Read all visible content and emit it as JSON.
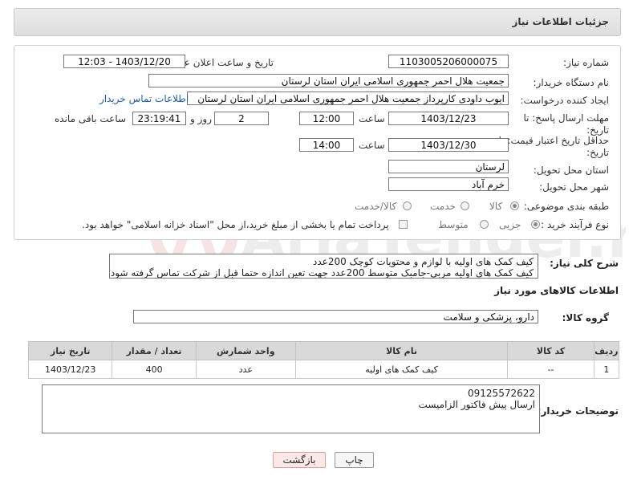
{
  "header": {
    "title": "جزئیات اطلاعات نیاز"
  },
  "form": {
    "need_number_label": "شماره نیاز:",
    "need_number": "1103005206000075",
    "announce_label": "تاریخ و ساعت اعلان عمومی:",
    "announce_value": "1403/12/20 - 12:03",
    "buyer_org_label": "نام دستگاه خریدار:",
    "buyer_org": "جمعیت هلال احمر جمهوری اسلامی ایران استان لرستان",
    "requester_label": "ایجاد کننده درخواست:",
    "requester": "ایوب داودی کارپرداز جمعیت هلال احمر جمهوری اسلامی ایران استان لرستان",
    "buyer_contact_link": "اطلاعات تماس خریدار",
    "reply_deadline_label": "مهلت ارسال پاسخ: تا تاریخ:",
    "reply_date": "1403/12/23",
    "time_label": "ساعت",
    "reply_time": "12:00",
    "days_value": "2",
    "days_label": "روز و",
    "remaining_time": "23:19:41",
    "remaining_label": "ساعت باقی مانده",
    "price_validity_label": "حداقل تاریخ اعتبار قیمت: تا تاریخ:",
    "validity_date": "1403/12/30",
    "validity_time": "14:00",
    "province_label": "استان محل تحویل:",
    "province": "لرستان",
    "city_label": "شهر محل تحویل:",
    "city": "خرم آباد",
    "category_label": "طبقه بندی موضوعی:",
    "category_options": [
      "کالا",
      "خدمت",
      "کالا/خدمت"
    ],
    "category_selected": "کالا",
    "process_label": "نوع فرآیند خرید :",
    "process_options": [
      "جزیی",
      "متوسط"
    ],
    "process_selected": "جزیی",
    "payment_note": "پرداخت تمام یا بخشی از مبلغ خرید،از محل \"اسناد خزانه اسلامی\" خواهد بود."
  },
  "description": {
    "label": "شرح کلی نیاز:",
    "line1": "کیف کمک های اولیه  با لوازم و محتویات کوچک 200عدد",
    "line2": "کیف کمک های اولیه مربی-جامبک متوسط 200عدد جهت تعین اندازه حتما قبل از شرکت تماس گرفته شود"
  },
  "goods": {
    "section_title": "اطلاعات کالاهای مورد نیاز",
    "group_label": "گروه کالا:",
    "group_value": "دارو، پزشکی و سلامت",
    "columns": [
      "ردیف",
      "کد کالا",
      "نام کالا",
      "واحد شمارش",
      "تعداد / مقدار",
      "تاریخ نیاز"
    ],
    "rows": [
      [
        "1",
        "--",
        "کیف کمک های اولیه",
        "عدد",
        "400",
        "1403/12/23"
      ]
    ]
  },
  "buyer_notes": {
    "label": "توضیحات خریدار:",
    "line1": "09125572622",
    "line2": "ارسال پیش فاکتور الزامیست"
  },
  "buttons": {
    "print": "چاپ",
    "back": "بازگشت"
  },
  "colors": {
    "back_button_bg": "#fde8e8",
    "link": "#1a5fa8",
    "header_bg": "#e4e4e4"
  }
}
